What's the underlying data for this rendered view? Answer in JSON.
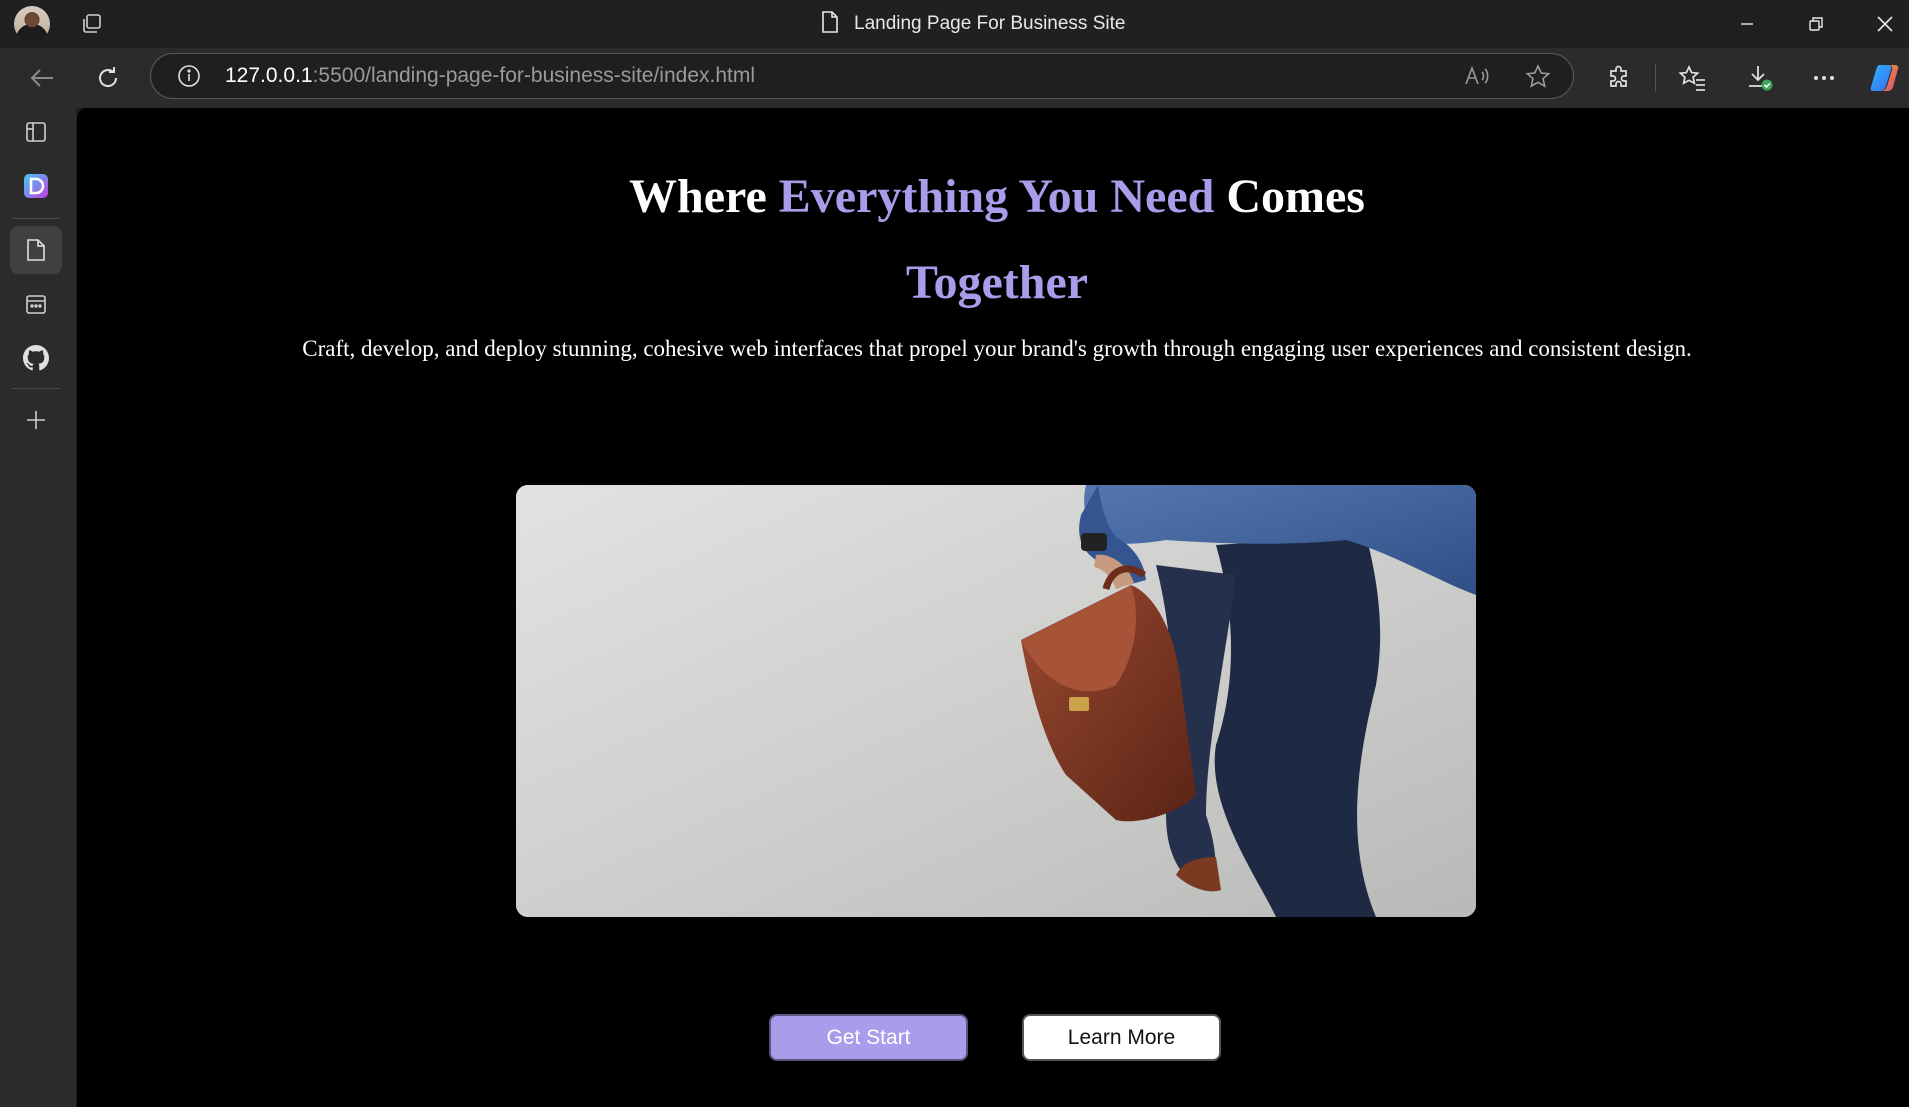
{
  "browser": {
    "tab_title": "Landing Page For Business Site",
    "url_host": "127.0.0.1",
    "url_rest": ":5500/landing-page-for-business-site/index.html",
    "toolbar_icons": [
      "read-aloud-icon",
      "favorite-star-icon",
      "extensions-icon",
      "favorites-icon",
      "downloads-icon",
      "more-icon",
      "copilot-icon"
    ],
    "sidebar_icons": [
      "vertical-tabs-icon",
      "app-d-icon",
      "page-icon",
      "calendar-icon",
      "github-icon",
      "add-icon"
    ]
  },
  "hero": {
    "title_part1": "Where ",
    "title_accent": "Everything You Need",
    "title_part2": " Comes ",
    "title_accent2": "Together",
    "subtitle": "Craft, develop, and deploy stunning, cohesive web interfaces that propel your brand's growth through engaging user experiences and consistent design.",
    "primary_button": "Get Start",
    "secondary_button": "Learn More"
  },
  "colors": {
    "accent": "#a99ceb",
    "background": "#000000",
    "browser_chrome": "#202020"
  }
}
